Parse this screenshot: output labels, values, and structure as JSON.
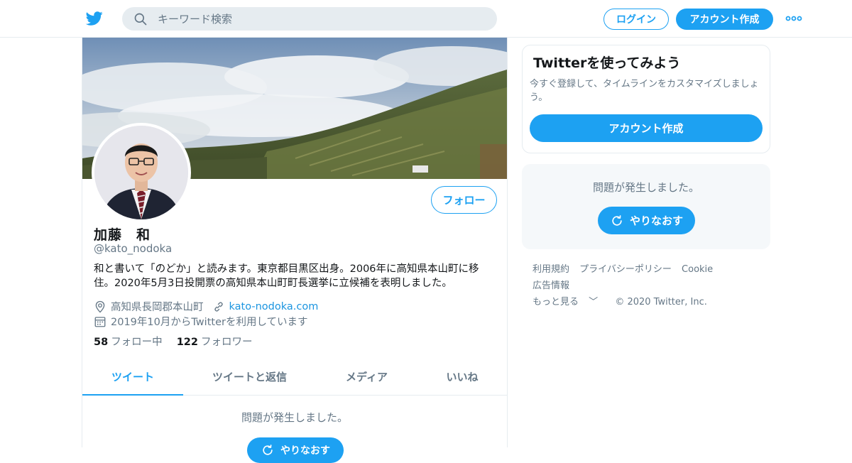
{
  "header": {
    "search_placeholder": "キーワード検索",
    "login_label": "ログイン",
    "signup_label": "アカウント作成"
  },
  "profile": {
    "name": "加藤　和",
    "handle": "@kato_nodoka",
    "bio": "和と書いて「のどか」と読みます。東京都目黒区出身。2006年に高知県本山町に移住。2020年5月3日投開票の高知県本山町町長選挙に立候補を表明しました。",
    "location": "高知県長岡郡本山町",
    "website": "kato-nodoka.com",
    "joined": "2019年10月からTwitterを利用しています",
    "following_count": "58",
    "following_label": "フォロー中",
    "followers_count": "122",
    "followers_label": "フォロワー",
    "follow_label": "フォロー"
  },
  "tabs": [
    {
      "label": "ツイート",
      "active": true
    },
    {
      "label": "ツイートと返信",
      "active": false
    },
    {
      "label": "メディア",
      "active": false
    },
    {
      "label": "いいね",
      "active": false
    }
  ],
  "timeline": {
    "error_message": "問題が発生しました。",
    "retry_label": "やりなおす"
  },
  "sidebar": {
    "signup_title": "Twitterを使ってみよう",
    "signup_desc": "今すぐ登録して、タイムラインをカスタマイズしましょう。",
    "signup_cta": "アカウント作成",
    "error_message": "問題が発生しました。",
    "retry_label": "やりなおす"
  },
  "footer": {
    "links": [
      "利用規約",
      "プライバシーポリシー",
      "Cookie",
      "広告情報",
      "もっと見る"
    ],
    "copyright": "© 2020 Twitter, Inc."
  },
  "colors": {
    "brand": "#1da1f2",
    "secondary_text": "#657786",
    "border": "#e6ecf0"
  }
}
